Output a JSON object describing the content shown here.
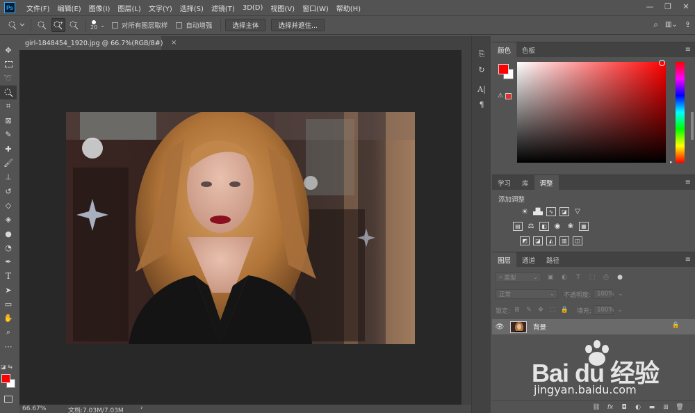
{
  "app": {
    "logo_text": "Ps"
  },
  "menu": [
    "文件(F)",
    "编辑(E)",
    "图像(I)",
    "图层(L)",
    "文字(Y)",
    "选择(S)",
    "滤镜(T)",
    "3D(D)",
    "视图(V)",
    "窗口(W)",
    "帮助(H)"
  ],
  "window_controls": {
    "minimize": "—",
    "restore": "❐",
    "close": "✕"
  },
  "options": {
    "brush_size": "20",
    "sample_all_layers": "对所有图层取样",
    "auto_enhance": "自动增强",
    "select_subject": "选择主体",
    "select_and_mask": "选择并遮住..."
  },
  "document": {
    "tab_title": "girl-1848454_1920.jpg @ 66.7%(RGB/8#)",
    "tab_close": "×",
    "zoom": "66.67%",
    "doc_info": "文档:7.03M/7.03M",
    "status_arrow": "›"
  },
  "color_panel": {
    "tabs": [
      "颜色",
      "色板"
    ],
    "active_tab": 0,
    "fg_color": "#ff0000",
    "bg_color": "#ffffff"
  },
  "adjust_panel": {
    "tabs": [
      "学习",
      "库",
      "调整"
    ],
    "active_tab": 2,
    "title": "添加调整"
  },
  "layers_panel": {
    "tabs": [
      "图层",
      "通道",
      "路径"
    ],
    "active_tab": 0,
    "filter_placeholder": "类型",
    "blend_mode": "正常",
    "opacity_label": "不透明度:",
    "opacity_value": "100%",
    "lock_label": "锁定:",
    "fill_label": "填充:",
    "fill_value": "100%",
    "layer_name": "背景"
  },
  "watermark": {
    "brand": "Bai du 经验",
    "url": "jingyan.baidu.com"
  },
  "icons": {
    "toolbar": [
      "move-icon",
      "marquee-icon",
      "lasso-icon",
      "quick-select-icon",
      "crop-icon",
      "frame-icon",
      "eyedropper-icon",
      "healing-icon",
      "brush-icon",
      "stamp-icon",
      "history-brush-icon",
      "eraser-icon",
      "paint-bucket-icon",
      "blur-icon",
      "dodge-icon",
      "pen-icon",
      "type-icon",
      "path-select-icon",
      "rectangle-icon",
      "hand-icon",
      "zoom-icon",
      "more-icon"
    ]
  }
}
